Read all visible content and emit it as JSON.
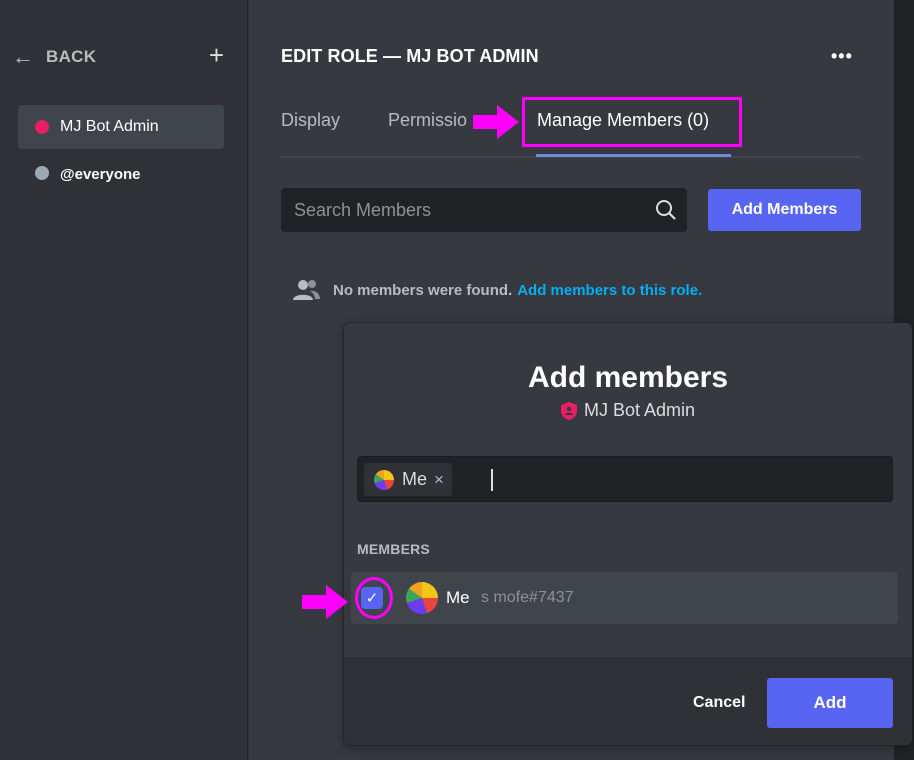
{
  "sidebar": {
    "back_label": "BACK",
    "add_label": "+",
    "roles": [
      {
        "name": "MJ Bot Admin",
        "color": "#e91e63",
        "active": true
      },
      {
        "name": "@everyone",
        "color": "#99aab5",
        "active": false
      }
    ]
  },
  "main": {
    "title": "EDIT ROLE — MJ BOT ADMIN",
    "more_label": "•••",
    "tabs": [
      {
        "label": "Display"
      },
      {
        "label": "Permissio"
      },
      {
        "label": "Manage Members (0)"
      }
    ],
    "search_placeholder": "Search Members",
    "add_members_button": "Add Members",
    "empty_text": "No members were found.",
    "empty_link": "Add members to this role."
  },
  "modal": {
    "title": "Add members",
    "subtitle": "MJ Bot Admin",
    "chip_label": "Me",
    "chip_remove": "×",
    "members_heading": "MEMBERS",
    "member": {
      "name": "Me",
      "tag": "s mofe#7437",
      "checked": true
    },
    "cancel_button": "Cancel",
    "add_button": "Add"
  },
  "colors": {
    "accent": "#5865f2",
    "link": "#00aff4",
    "highlight": "#ff00ff",
    "role_color": "#e91e63"
  }
}
